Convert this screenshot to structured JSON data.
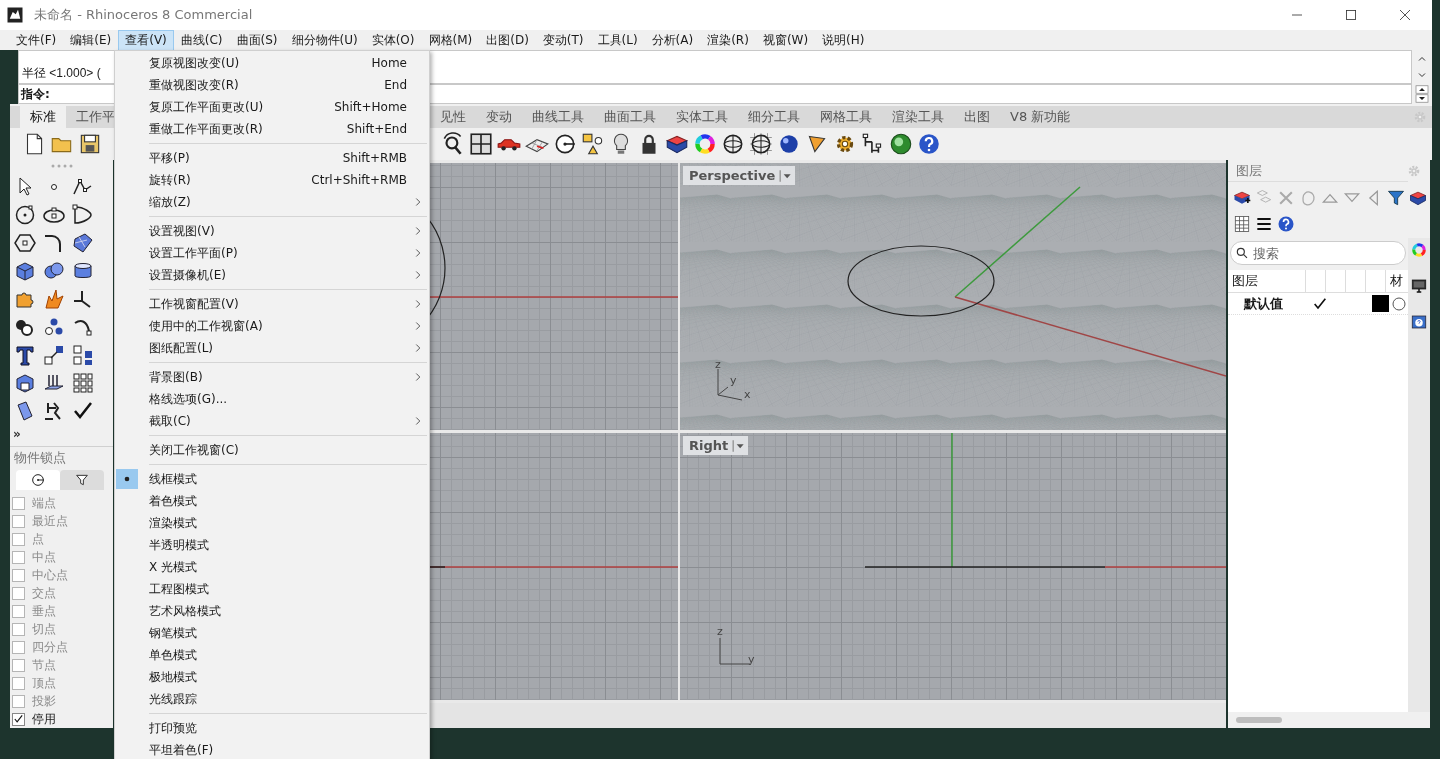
{
  "window": {
    "title": "未命名 - Rhinoceros 8 Commercial"
  },
  "menu_bar": [
    {
      "label": "文件(F)",
      "selected": false
    },
    {
      "label": "编辑(E)",
      "selected": false
    },
    {
      "label": "查看(V)",
      "selected": true
    },
    {
      "label": "曲线(C)",
      "selected": false
    },
    {
      "label": "曲面(S)",
      "selected": false
    },
    {
      "label": "细分物件(U)",
      "selected": false
    },
    {
      "label": "实体(O)",
      "selected": false
    },
    {
      "label": "网格(M)",
      "selected": false
    },
    {
      "label": "出图(D)",
      "selected": false
    },
    {
      "label": "变动(T)",
      "selected": false
    },
    {
      "label": "工具(L)",
      "selected": false
    },
    {
      "label": "分析(A)",
      "selected": false
    },
    {
      "label": "渲染(R)",
      "selected": false
    },
    {
      "label": "视窗(W)",
      "selected": false
    },
    {
      "label": "说明(H)",
      "selected": false
    }
  ],
  "command_history": [
    "半径 <1.000> ("
  ],
  "command_prompt": "指令:",
  "toolbar_tabs": {
    "left": [
      {
        "label": "标准",
        "selected": true
      },
      {
        "label": "工作平",
        "selected": false
      }
    ],
    "right": [
      {
        "label": "见性",
        "selected": false
      },
      {
        "label": "变动",
        "selected": false
      },
      {
        "label": "曲线工具",
        "selected": false
      },
      {
        "label": "曲面工具",
        "selected": false
      },
      {
        "label": "实体工具",
        "selected": false
      },
      {
        "label": "细分工具",
        "selected": false
      },
      {
        "label": "网格工具",
        "selected": false
      },
      {
        "label": "渲染工具",
        "selected": false
      },
      {
        "label": "出图",
        "selected": false
      },
      {
        "label": "V8 新功能",
        "selected": false
      }
    ]
  },
  "toolbox": {
    "more": "»"
  },
  "osnap": {
    "title": "物件锁点",
    "tabs": [
      {
        "kind": "snaps",
        "selected": true
      },
      {
        "kind": "filter",
        "selected": false
      }
    ],
    "items": [
      {
        "label": "端点",
        "checked": false,
        "disabled": true
      },
      {
        "label": "最近点",
        "checked": false,
        "disabled": true
      },
      {
        "label": "点",
        "checked": false,
        "disabled": true
      },
      {
        "label": "中点",
        "checked": false,
        "disabled": true
      },
      {
        "label": "中心点",
        "checked": false,
        "disabled": true
      },
      {
        "label": "交点",
        "checked": false,
        "disabled": true
      },
      {
        "label": "垂点",
        "checked": false,
        "disabled": true
      },
      {
        "label": "切点",
        "checked": false,
        "disabled": true
      },
      {
        "label": "四分点",
        "checked": false,
        "disabled": true
      },
      {
        "label": "节点",
        "checked": false,
        "disabled": true
      },
      {
        "label": "顶点",
        "checked": false,
        "disabled": true
      },
      {
        "label": "投影",
        "checked": false,
        "disabled": true
      },
      {
        "label": "停用",
        "checked": true,
        "disabled": false
      }
    ]
  },
  "viewports": [
    {
      "kind": "top"
    },
    {
      "kind": "perspective",
      "title": "Perspective",
      "axes": [
        "z",
        "y",
        "x"
      ]
    },
    {
      "kind": "front"
    },
    {
      "kind": "right",
      "title": "Right",
      "axes": [
        "z",
        "y"
      ]
    }
  ],
  "layers_panel": {
    "title": "图层",
    "search": {
      "placeholder": "搜索"
    },
    "columns": [
      "图层",
      "材"
    ],
    "layers": [
      {
        "name": "默认值",
        "current": true,
        "color": "#000000"
      }
    ]
  },
  "view_menu": [
    {
      "kind": "item",
      "label": "复原视图改变(U)",
      "shortcut": "Home"
    },
    {
      "kind": "item",
      "label": "重做视图改变(R)",
      "shortcut": "End"
    },
    {
      "kind": "item",
      "label": "复原工作平面更改(U)",
      "shortcut": "Shift+Home"
    },
    {
      "kind": "item",
      "label": "重做工作平面更改(R)",
      "shortcut": "Shift+End"
    },
    {
      "kind": "separator"
    },
    {
      "kind": "item",
      "label": "平移(P)",
      "shortcut": "Shift+RMB"
    },
    {
      "kind": "item",
      "label": "旋转(R)",
      "shortcut": "Ctrl+Shift+RMB"
    },
    {
      "kind": "submenu",
      "label": "缩放(Z)"
    },
    {
      "kind": "separator"
    },
    {
      "kind": "submenu",
      "label": "设置视图(V)"
    },
    {
      "kind": "submenu",
      "label": "设置工作平面(P)"
    },
    {
      "kind": "submenu",
      "label": "设置摄像机(E)"
    },
    {
      "kind": "separator"
    },
    {
      "kind": "submenu",
      "label": "工作视窗配置(V)"
    },
    {
      "kind": "submenu",
      "label": "使用中的工作视窗(A)"
    },
    {
      "kind": "submenu",
      "label": "图纸配置(L)"
    },
    {
      "kind": "separator"
    },
    {
      "kind": "submenu",
      "label": "背景图(B)"
    },
    {
      "kind": "item",
      "label": "格线选项(G)..."
    },
    {
      "kind": "submenu",
      "label": "截取(C)"
    },
    {
      "kind": "separator"
    },
    {
      "kind": "item",
      "label": "关闭工作视窗(C)"
    },
    {
      "kind": "separator"
    },
    {
      "kind": "radio",
      "label": "线框模式",
      "selected": true
    },
    {
      "kind": "radio",
      "label": "着色模式",
      "selected": false
    },
    {
      "kind": "radio",
      "label": "渲染模式",
      "selected": false
    },
    {
      "kind": "radio",
      "label": "半透明模式",
      "selected": false
    },
    {
      "kind": "radio",
      "label": "X 光模式",
      "selected": false
    },
    {
      "kind": "radio",
      "label": "工程图模式",
      "selected": false
    },
    {
      "kind": "radio",
      "label": "艺术风格模式",
      "selected": false
    },
    {
      "kind": "radio",
      "label": "钢笔模式",
      "selected": false
    },
    {
      "kind": "radio",
      "label": "单色模式",
      "selected": false
    },
    {
      "kind": "radio",
      "label": "极地模式",
      "selected": false
    },
    {
      "kind": "radio",
      "label": "光线跟踪",
      "selected": false
    },
    {
      "kind": "separator"
    },
    {
      "kind": "item",
      "label": "打印预览"
    },
    {
      "kind": "item",
      "label": "平坦着色(F)"
    }
  ]
}
